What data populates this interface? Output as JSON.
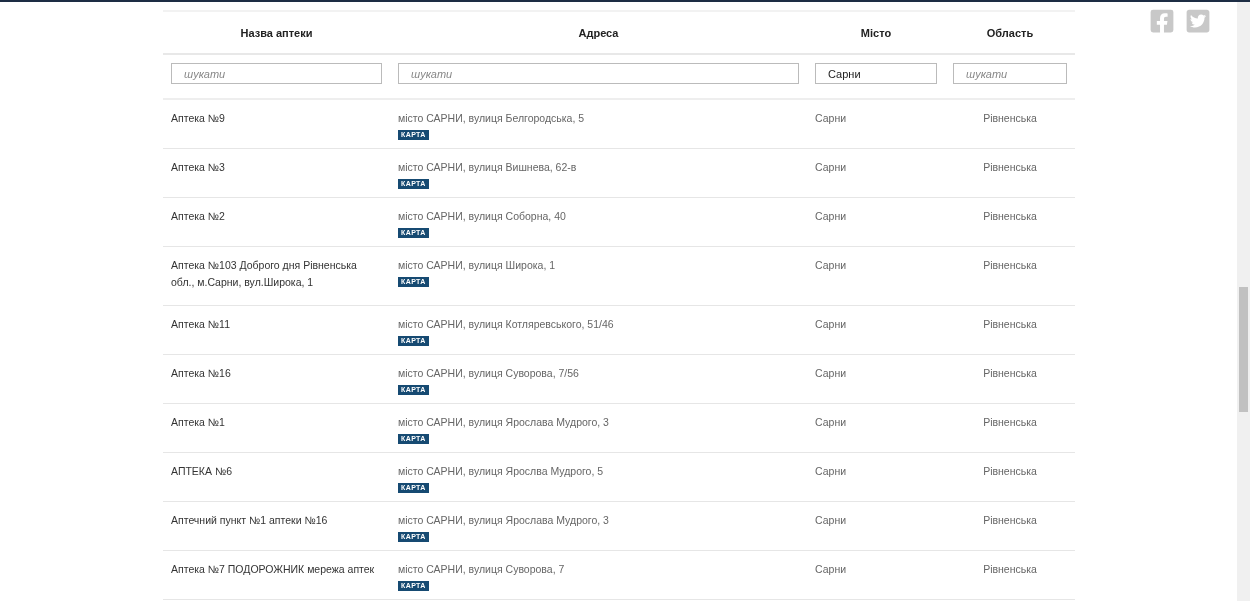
{
  "table": {
    "columns": [
      "Назва аптеки",
      "Адреса",
      "Місто",
      "Область"
    ],
    "filters": [
      {
        "placeholder": "шукати"
      },
      {
        "placeholder": "шукати"
      },
      {
        "value": "Сарни"
      },
      {
        "placeholder": "шукати"
      }
    ],
    "rows": [
      {
        "name": "Аптека №9",
        "address": "місто САРНИ, вулиця Белгородська, 5",
        "map_link": "КАРТА",
        "city": "Сарни",
        "region": "Рівненська"
      },
      {
        "name": "Аптека №3",
        "address": "місто САРНИ, вулиця Вишнева, 62-в",
        "map_link": "КАРТА",
        "city": "Сарни",
        "region": "Рівненська"
      },
      {
        "name": "Аптека №2",
        "address": "місто САРНИ, вулиця Соборна, 40",
        "map_link": "КАРТА",
        "city": "Сарни",
        "region": "Рівненська"
      },
      {
        "name": "Аптека №103 Доброго дня Рівненська обл., м.Сарни, вул.Широка, 1",
        "address": "місто САРНИ, вулиця Широка, 1",
        "map_link": "КАРТА",
        "city": "Сарни",
        "region": "Рівненська"
      },
      {
        "name": "Аптека №11",
        "address": "місто САРНИ, вулиця Котляревського, 51/46",
        "map_link": "КАРТА",
        "city": "Сарни",
        "region": "Рівненська"
      },
      {
        "name": "Аптека №16",
        "address": "місто САРНИ, вулиця Суворова, 7/56",
        "map_link": "КАРТА",
        "city": "Сарни",
        "region": "Рівненська"
      },
      {
        "name": "Аптека №1",
        "address": "місто САРНИ, вулиця Ярослава Мудрого, 3",
        "map_link": "КАРТА",
        "city": "Сарни",
        "region": "Рівненська"
      },
      {
        "name": "АПТЕКА №6",
        "address": "місто САРНИ, вулиця Ярослва Мудрого, 5",
        "map_link": "КАРТА",
        "city": "Сарни",
        "region": "Рівненська"
      },
      {
        "name": "Аптечний пункт №1 аптеки №16",
        "address": "місто САРНИ, вулиця Ярослава Мудрого, 3",
        "map_link": "КАРТА",
        "city": "Сарни",
        "region": "Рівненська"
      },
      {
        "name": "Аптека №7 ПОДОРОЖНИК мережа аптек",
        "address": "місто САРНИ, вулиця Суворова, 7",
        "map_link": "КАРТА",
        "city": "Сарни",
        "region": "Рівненська"
      }
    ]
  }
}
